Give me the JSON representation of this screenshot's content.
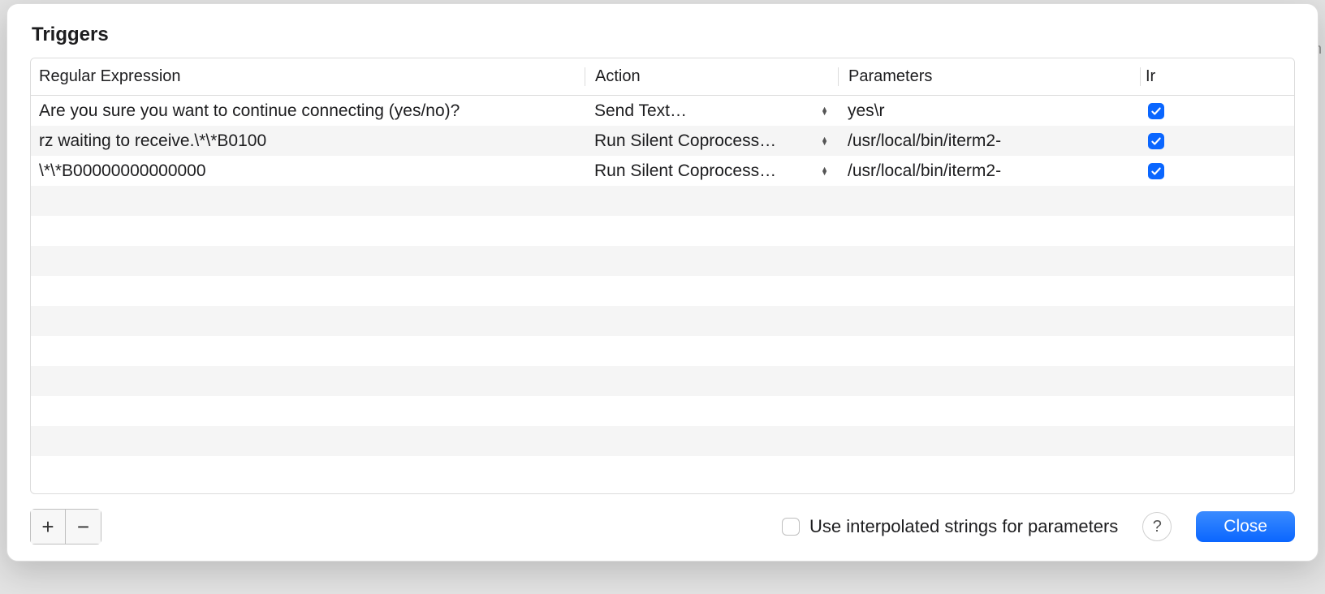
{
  "title": "Triggers",
  "columns": {
    "regex": "Regular Expression",
    "action": "Action",
    "params": "Parameters",
    "ir": "Ir"
  },
  "rows": [
    {
      "regex": "Are you sure you want to continue connecting (yes/no)?",
      "action": "Send Text…",
      "params": "yes\\r",
      "ir_checked": true
    },
    {
      "regex": "rz waiting to receive.\\*\\*B0100",
      "action": "Run Silent Coprocess…",
      "params": "/usr/local/bin/iterm2-",
      "ir_checked": true
    },
    {
      "regex": "\\*\\*B00000000000000",
      "action": "Run Silent Coprocess…",
      "params": "/usr/local/bin/iterm2-",
      "ir_checked": true
    }
  ],
  "footer": {
    "add_label": "+",
    "remove_label": "−",
    "interp_label": "Use interpolated strings for parameters",
    "interp_checked": false,
    "help_label": "?",
    "close_label": "Close"
  }
}
